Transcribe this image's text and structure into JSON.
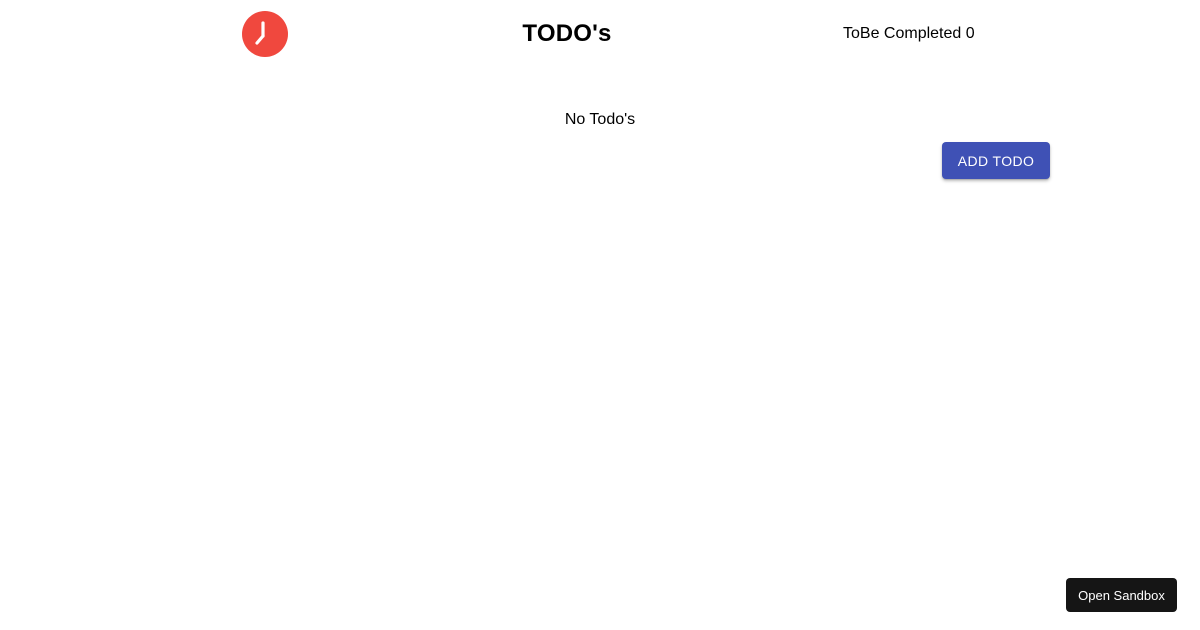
{
  "header": {
    "logo_icon": "clock-icon",
    "logo_color": "#f0483e",
    "title": "TODO's",
    "counter_label": "ToBe Completed 0"
  },
  "main": {
    "empty_message": "No Todo's",
    "add_button_label": "ADD TODO",
    "accent_color": "#3f51b5"
  },
  "footer": {
    "sandbox_button_label": "Open Sandbox"
  }
}
